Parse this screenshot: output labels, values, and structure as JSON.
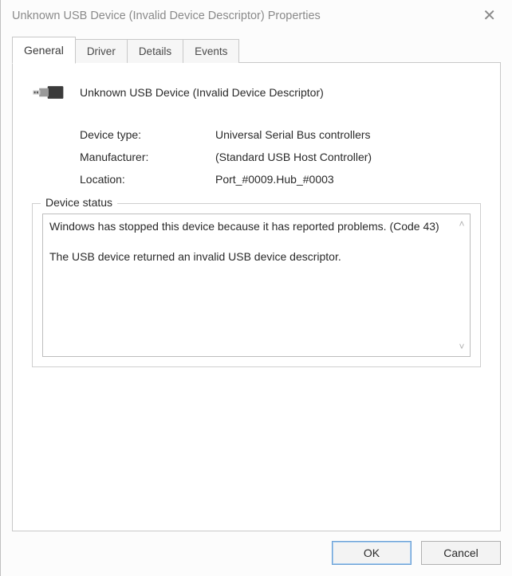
{
  "window": {
    "title": "Unknown USB Device (Invalid Device Descriptor) Properties"
  },
  "tabs": [
    {
      "label": "General",
      "active": true
    },
    {
      "label": "Driver",
      "active": false
    },
    {
      "label": "Details",
      "active": false
    },
    {
      "label": "Events",
      "active": false
    }
  ],
  "device": {
    "name": "Unknown USB Device (Invalid Device Descriptor)",
    "rows": [
      {
        "label": "Device type:",
        "value": "Universal Serial Bus controllers"
      },
      {
        "label": "Manufacturer:",
        "value": "(Standard USB Host Controller)"
      },
      {
        "label": "Location:",
        "value": "Port_#0009.Hub_#0003"
      }
    ]
  },
  "status": {
    "legend": "Device status",
    "text": "Windows has stopped this device because it has reported problems. (Code 43)\n\nThe USB device returned an invalid USB device descriptor."
  },
  "buttons": {
    "ok": "OK",
    "cancel": "Cancel"
  }
}
